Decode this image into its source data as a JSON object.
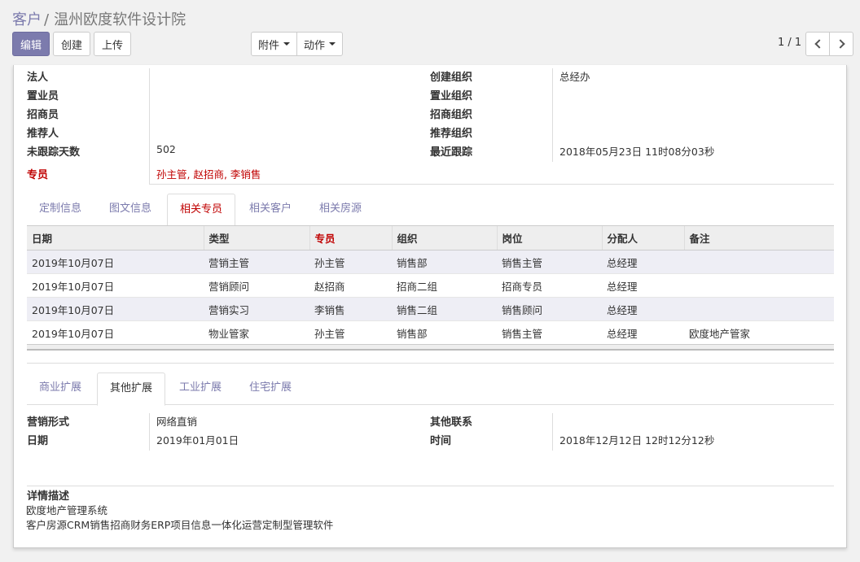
{
  "breadcrumb": {
    "parent": "客户",
    "separator": "/",
    "current": "温州欧度软件设计院"
  },
  "toolbar": {
    "edit": "编辑",
    "create": "创建",
    "upload": "上传",
    "attachment": "附件",
    "action": "动作"
  },
  "pager": {
    "value": "1 / 1"
  },
  "colors": {
    "primary": "#7c7bad",
    "required": "#c00000",
    "row_stripe": "#eeeef5"
  },
  "fields_left": [
    {
      "label": "法人",
      "value": ""
    },
    {
      "label": "置业员",
      "value": ""
    },
    {
      "label": "招商员",
      "value": ""
    },
    {
      "label": "推荐人",
      "value": ""
    },
    {
      "label": "未跟踪天数",
      "value": "502"
    }
  ],
  "fields_right": [
    {
      "label": "创建组织",
      "value": "总经办"
    },
    {
      "label": "置业组织",
      "value": ""
    },
    {
      "label": "招商组织",
      "value": ""
    },
    {
      "label": "推荐组织",
      "value": ""
    },
    {
      "label": "最近跟踪",
      "value": "2018年05月23日 11时08分03秒"
    }
  ],
  "specialist": {
    "label": "专员",
    "value": "孙主管, 赵招商, 李销售"
  },
  "tabs1": [
    "定制信息",
    "图文信息",
    "相关专员",
    "相关客户",
    "相关房源"
  ],
  "table": {
    "headers": [
      "日期",
      "类型",
      "专员",
      "组织",
      "岗位",
      "分配人",
      "备注"
    ],
    "rows": [
      [
        "2019年10月07日",
        "营销主管",
        "孙主管",
        "销售部",
        "销售主管",
        "总经理",
        ""
      ],
      [
        "2019年10月07日",
        "营销顾问",
        "赵招商",
        "招商二组",
        "招商专员",
        "总经理",
        ""
      ],
      [
        "2019年10月07日",
        "营销实习",
        "李销售",
        "销售二组",
        "销售顾问",
        "总经理",
        ""
      ],
      [
        "2019年10月07日",
        "物业管家",
        "孙主管",
        "销售部",
        "销售主管",
        "总经理",
        "欧度地产管家"
      ]
    ]
  },
  "tabs2": [
    "商业扩展",
    "其他扩展",
    "工业扩展",
    "住宅扩展"
  ],
  "ext": {
    "marketing_label": "营销形式",
    "marketing_value": "网络直销",
    "date_label": "日期",
    "date_value": "2019年01月01日",
    "other_label": "其他联系",
    "other_value": "",
    "time_label": "时间",
    "time_value": "2018年12月12日 12时12分12秒"
  },
  "detail": {
    "label": "详情描述",
    "line1": "欧度地产管理系统",
    "line2": "客户房源CRM销售招商财务ERP项目信息一体化运营定制型管理软件"
  }
}
